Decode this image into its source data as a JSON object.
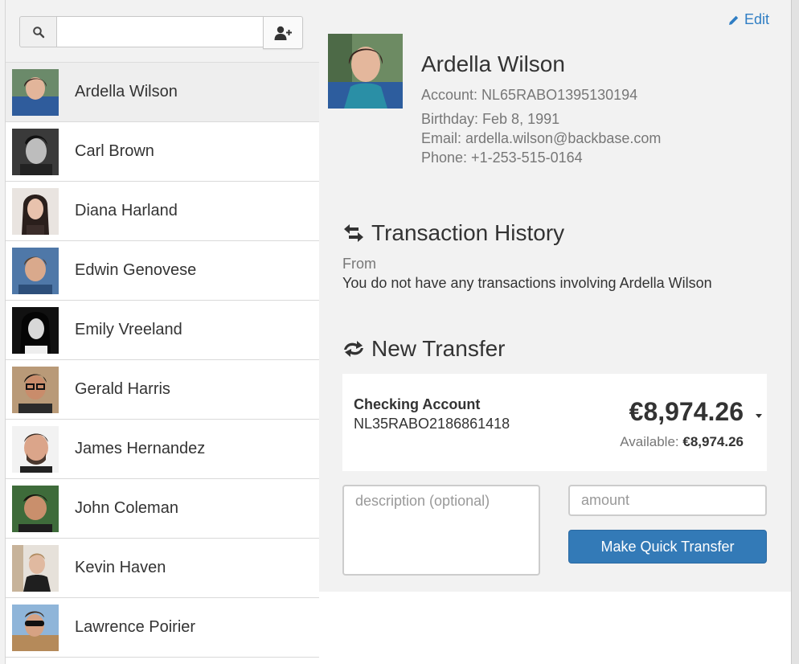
{
  "search": {
    "value": "",
    "placeholder": ""
  },
  "contacts": [
    {
      "name": "Ardella Wilson",
      "selected": true
    },
    {
      "name": "Carl Brown"
    },
    {
      "name": "Diana Harland"
    },
    {
      "name": "Edwin Genovese"
    },
    {
      "name": "Emily Vreeland"
    },
    {
      "name": "Gerald Harris"
    },
    {
      "name": "James Hernandez"
    },
    {
      "name": "John Coleman"
    },
    {
      "name": "Kevin Haven"
    },
    {
      "name": "Lawrence Poirier"
    }
  ],
  "detail": {
    "edit_label": "Edit",
    "name": "Ardella Wilson",
    "account": "Account: NL65RABO1395130194",
    "birthday": "Birthday: Feb 8, 1991",
    "email": "Email: ardella.wilson@backbase.com",
    "phone": "Phone: +1-253-515-0164"
  },
  "transaction_history": {
    "title": "Transaction History",
    "from_label": "From",
    "empty_message": "You do not have any transactions involving Ardella Wilson"
  },
  "new_transfer": {
    "title": "New Transfer",
    "account_name": "Checking Account",
    "account_iban": "NL35RABO2186861418",
    "balance": "€8,974.26",
    "available_label": "Available:",
    "available_amount": "€8,974.26",
    "description_placeholder": "description (optional)",
    "amount_placeholder": "amount",
    "button_label": "Make Quick Transfer"
  },
  "colors": {
    "accent": "#337ab7",
    "link": "#2f7ec4",
    "panel_bg": "#f2f2f2"
  }
}
